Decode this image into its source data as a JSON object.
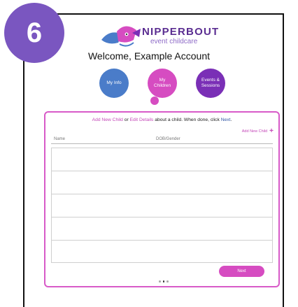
{
  "step_number": "6",
  "brand": {
    "name": "NIPPERBOUT",
    "tagline": "event childcare"
  },
  "welcome_text": "Welcome, Example Account",
  "steps": [
    {
      "label_line1": "My Info",
      "label_line2": "",
      "color": "#4a7cc9"
    },
    {
      "label_line1": "My",
      "label_line2": "Children",
      "color": "#d64cc1"
    },
    {
      "label_line1": "Events &",
      "label_line2": "Sessions",
      "color": "#7a2fb6"
    }
  ],
  "instructions": {
    "add_link": "Add New Child",
    "or_text": " or ",
    "edit_link": "Edit Details",
    "middle_text": " about a child. When done, click ",
    "next_word": "Next",
    "end": "."
  },
  "add_new_child_label": "Add New Child",
  "table": {
    "headers": [
      "Name",
      "DOB/Gender"
    ],
    "rows": [
      [
        "",
        ""
      ],
      [
        "",
        ""
      ],
      [
        "",
        ""
      ],
      [
        "",
        ""
      ],
      [
        "",
        ""
      ]
    ]
  },
  "next_button_label": "Next",
  "pager": {
    "pages": 3,
    "current": 2
  },
  "colors": {
    "badge": "#7a56c0",
    "accent_pink": "#d64cc1",
    "brand_purple": "#5a2d91"
  }
}
